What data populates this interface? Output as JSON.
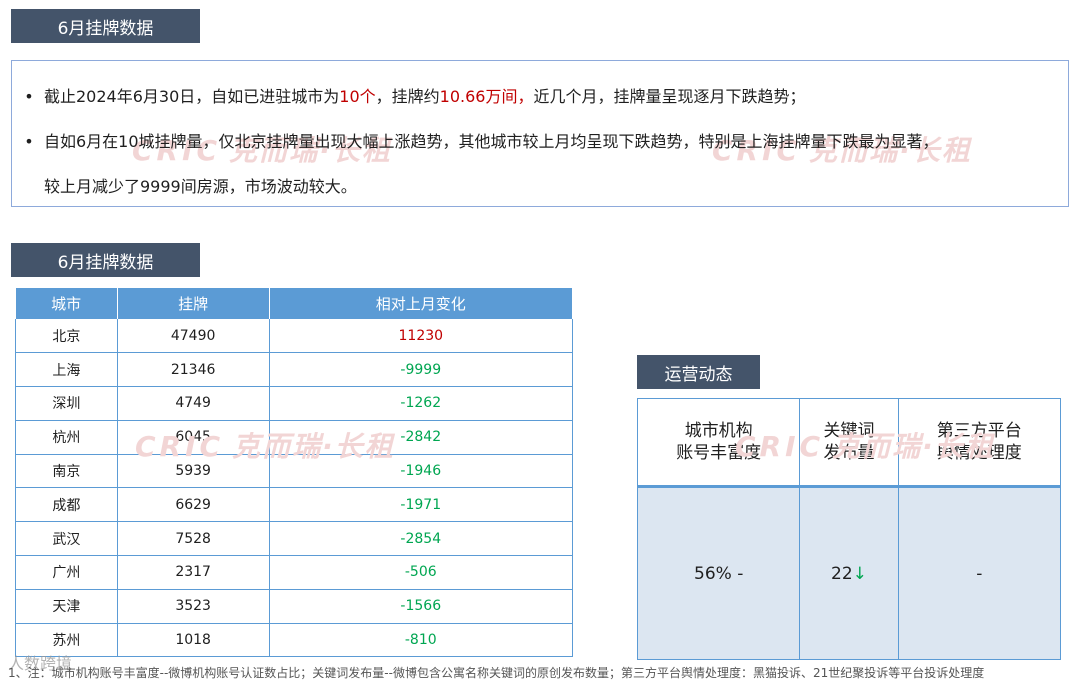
{
  "section1": {
    "title": "6月挂牌数据"
  },
  "summary": {
    "bullet1": {
      "pre": "截止2024年6月30日，自如已进驻城市为",
      "highlight1": "10个",
      "mid": "，挂牌约",
      "highlight2": "10.66万间，",
      "post": "近几个月，挂牌量呈现逐月下跌趋势；"
    },
    "bullet2": {
      "line1": "自如6月在10城挂牌量，仅北京挂牌量出现大幅上涨趋势，其他城市较上月均呈现下跌趋势，特别是上海挂牌量下跌最为显著，",
      "line2": "较上月减少了9999间房源，市场波动较大。"
    },
    "bullet_symbol": "•"
  },
  "watermark": {
    "latin": "CRIC",
    "cn": "克而瑞·长租"
  },
  "section2": {
    "title": "6月挂牌数据"
  },
  "listing_table": {
    "headers": [
      "城市",
      "挂牌",
      "相对上月变化"
    ],
    "rows": [
      {
        "city": "北京",
        "listings": "47490",
        "change": "11230"
      },
      {
        "city": "上海",
        "listings": "21346",
        "change": "-9999"
      },
      {
        "city": "深圳",
        "listings": "4749",
        "change": "-1262"
      },
      {
        "city": "杭州",
        "listings": "6045",
        "change": "-2842"
      },
      {
        "city": "南京",
        "listings": "5939",
        "change": "-1946"
      },
      {
        "city": "成都",
        "listings": "6629",
        "change": "-1971"
      },
      {
        "city": "武汉",
        "listings": "7528",
        "change": "-2854"
      },
      {
        "city": "广州",
        "listings": "2317",
        "change": "-506"
      },
      {
        "city": "天津",
        "listings": "3523",
        "change": "-1566"
      },
      {
        "city": "苏州",
        "listings": "1018",
        "change": "-810"
      }
    ]
  },
  "section3": {
    "title": "运营动态"
  },
  "ops_table": {
    "headers": [
      {
        "line1": "城市机构",
        "line2": "账号丰富度"
      },
      {
        "line1": "关键词",
        "line2": "发布量"
      },
      {
        "line1": "第三方平台",
        "line2": "舆情处理度"
      }
    ],
    "values": {
      "richness": "56% -",
      "keywords": "22",
      "keywords_arrow": "↓",
      "sentiment": "-"
    }
  },
  "footnote": "1、注：城市机构账号丰富度--微博机构账号认证数占比；关键词发布量--微博包含公寓名称关键词的原创发布数量；第三方平台舆情处理度：黑猫投诉、21世纪聚投诉等平台投诉处理度",
  "bottom_logo": "人数跨境",
  "colors": {
    "tag_bg": "#44546a",
    "table_header": "#5b9bd5",
    "highlight_red": "#c00000",
    "decline_green": "#00a651",
    "ops_cell_bg": "#dce6f1"
  }
}
